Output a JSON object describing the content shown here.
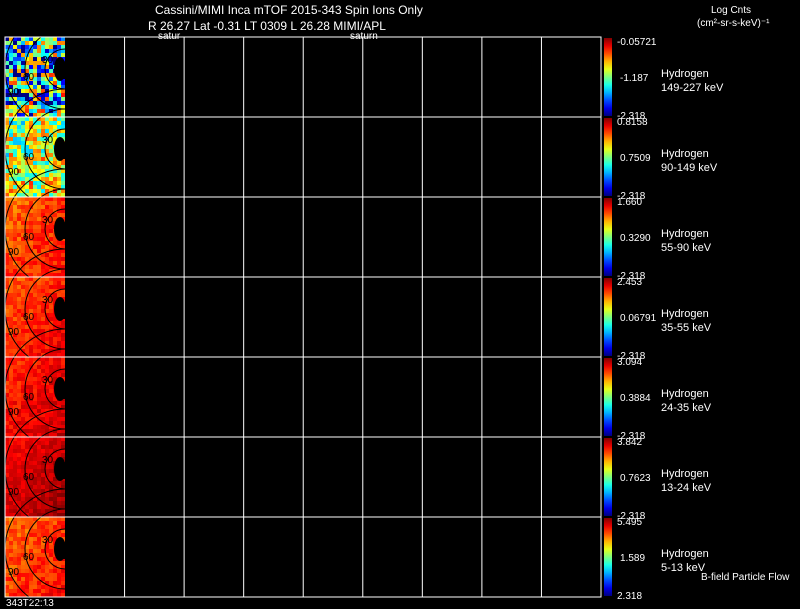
{
  "header": {
    "title_line": "Cassini/MIMI Inca mTOF  2015-343   Spin   Ions Only",
    "info_line": "R          26.27 Lat -0.31 LT 0309 L          26.28  MIMI/APL",
    "sub_left": "satur",
    "sub_right": "saturn",
    "units_line1": "Log Cnts",
    "units_line2": "(cm²-sr-s-keV)⁻¹"
  },
  "footer": {
    "time_label": "343T22:13",
    "bfield_label": "B-field Particle Flow"
  },
  "chart_data": {
    "type": "heatmap",
    "title": "Cassini/MIMI Inca mTOF  2015-343   Spin   Ions Only",
    "time": "343T22:13",
    "angle_contours": [
      "30",
      "60",
      "90"
    ],
    "grid": true,
    "panels": [
      {
        "species": "Hydrogen",
        "energy": "149-227 keV",
        "cbar_max": "-0.05721",
        "cbar_mid": "-1.187",
        "cbar_min": "-2.318",
        "level": 0.35,
        "noise": 0.45
      },
      {
        "species": "Hydrogen",
        "energy": "90-149 keV",
        "cbar_max": "0.8158",
        "cbar_mid": "0.7509",
        "cbar_min": "-2.318",
        "level": 0.55,
        "noise": 0.25
      },
      {
        "species": "Hydrogen",
        "energy": "55-90 keV",
        "cbar_max": "1.660",
        "cbar_mid": "0.3290",
        "cbar_min": "-2.318",
        "level": 0.8,
        "noise": 0.06
      },
      {
        "species": "Hydrogen",
        "energy": "35-55 keV",
        "cbar_max": "2.453",
        "cbar_mid": "0.06791",
        "cbar_min": "-2.318",
        "level": 0.82,
        "noise": 0.05
      },
      {
        "species": "Hydrogen",
        "energy": "24-35 keV",
        "cbar_max": "3.094",
        "cbar_mid": "0.3884",
        "cbar_min": "-2.318",
        "level": 0.86,
        "noise": 0.05
      },
      {
        "species": "Hydrogen",
        "energy": "13-24 keV",
        "cbar_max": "3.842",
        "cbar_mid": "0.7623",
        "cbar_min": "-2.318",
        "level": 0.9,
        "noise": 0.04
      },
      {
        "species": "Hydrogen",
        "energy": "5-13 keV",
        "cbar_max": "5.495",
        "cbar_mid": "1.589",
        "cbar_min": "2.318",
        "level": 0.8,
        "noise": 0.06
      }
    ]
  }
}
